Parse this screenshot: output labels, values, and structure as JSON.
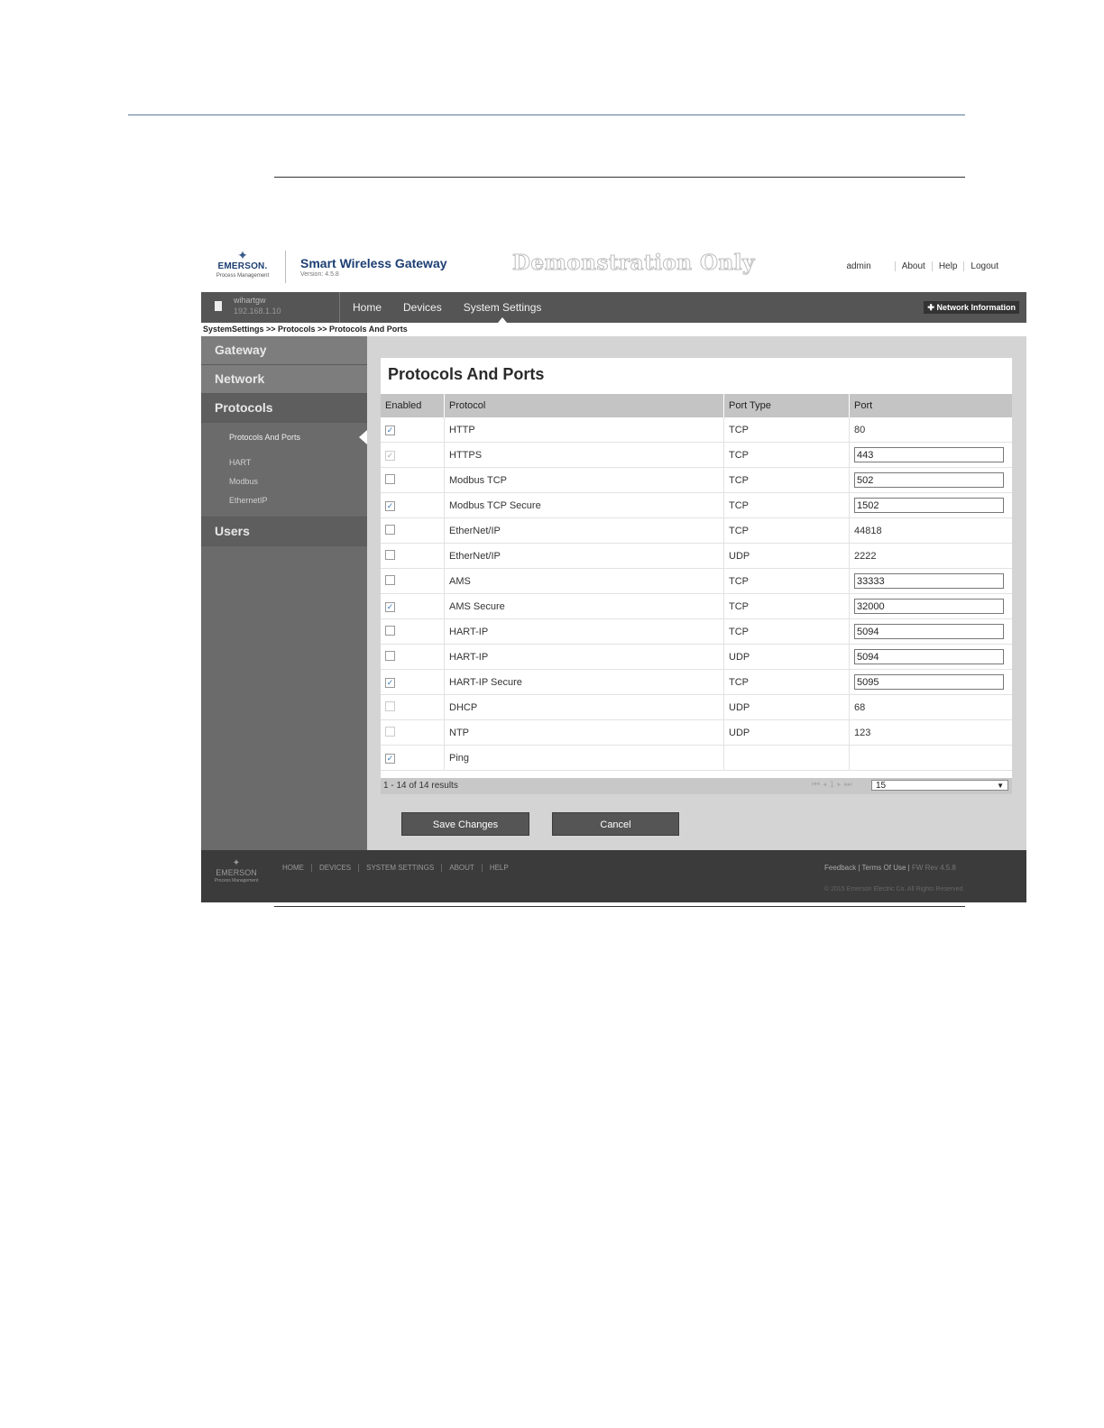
{
  "header": {
    "logo_name": "EMERSON.",
    "logo_sub": "Process Management",
    "app_title": "Smart Wireless Gateway",
    "version": "Version: 4.5.8",
    "watermark": "Demonstration Only",
    "user": "admin",
    "links": [
      "About",
      "Help",
      "Logout"
    ]
  },
  "nav": {
    "device_name": "wihartgw",
    "device_ip": "192.168.1.10",
    "tabs": [
      "Home",
      "Devices",
      "System Settings"
    ],
    "network_info": "Network Information"
  },
  "breadcrumb": "SystemSettings >> Protocols >> Protocols And Ports",
  "sidebar": {
    "gateway": "Gateway",
    "network": "Network",
    "protocols": "Protocols",
    "sub_items": [
      "Protocols And Ports",
      "HART",
      "Modbus",
      "EthernetIP"
    ],
    "users": "Users"
  },
  "main": {
    "title": "Protocols And Ports",
    "columns": [
      "Enabled",
      "Protocol",
      "Port Type",
      "Port"
    ],
    "rows": [
      {
        "enabled": true,
        "disabled": false,
        "protocol": "HTTP",
        "type": "TCP",
        "port": "80",
        "editable": false
      },
      {
        "enabled": true,
        "disabled": true,
        "protocol": "HTTPS",
        "type": "TCP",
        "port": "443",
        "editable": true
      },
      {
        "enabled": false,
        "disabled": false,
        "protocol": "Modbus TCP",
        "type": "TCP",
        "port": "502",
        "editable": true
      },
      {
        "enabled": true,
        "disabled": false,
        "protocol": "Modbus TCP Secure",
        "type": "TCP",
        "port": "1502",
        "editable": true
      },
      {
        "enabled": false,
        "disabled": false,
        "protocol": "EtherNet/IP",
        "type": "TCP",
        "port": "44818",
        "editable": false
      },
      {
        "enabled": false,
        "disabled": false,
        "protocol": "EtherNet/IP",
        "type": "UDP",
        "port": "2222",
        "editable": false
      },
      {
        "enabled": false,
        "disabled": false,
        "protocol": "AMS",
        "type": "TCP",
        "port": "33333",
        "editable": true
      },
      {
        "enabled": true,
        "disabled": false,
        "protocol": "AMS Secure",
        "type": "TCP",
        "port": "32000",
        "editable": true
      },
      {
        "enabled": false,
        "disabled": false,
        "protocol": "HART-IP",
        "type": "TCP",
        "port": "5094",
        "editable": true
      },
      {
        "enabled": false,
        "disabled": false,
        "protocol": "HART-IP",
        "type": "UDP",
        "port": "5094",
        "editable": true
      },
      {
        "enabled": true,
        "disabled": false,
        "protocol": "HART-IP Secure",
        "type": "TCP",
        "port": "5095",
        "editable": true
      },
      {
        "enabled": false,
        "disabled": true,
        "protocol": "DHCP",
        "type": "UDP",
        "port": "68",
        "editable": false
      },
      {
        "enabled": false,
        "disabled": true,
        "protocol": "NTP",
        "type": "UDP",
        "port": "123",
        "editable": false
      },
      {
        "enabled": true,
        "disabled": false,
        "protocol": "Ping",
        "type": "",
        "port": "",
        "editable": false
      }
    ],
    "results": "1 - 14 of 14 results",
    "page_size": "15",
    "save_label": "Save Changes",
    "cancel_label": "Cancel"
  },
  "footer": {
    "logo_name": "EMERSON",
    "logo_sub": "Process Management",
    "links": [
      "HOME",
      "DEVICES",
      "SYSTEM SETTINGS",
      "ABOUT",
      "HELP"
    ],
    "feedback": "Feedback",
    "terms": "Terms Of Use",
    "fw_rev": "FW Rev 4.5.8",
    "copyright": "© 2015 Emerson Electric Co. All Rights Reserved."
  }
}
